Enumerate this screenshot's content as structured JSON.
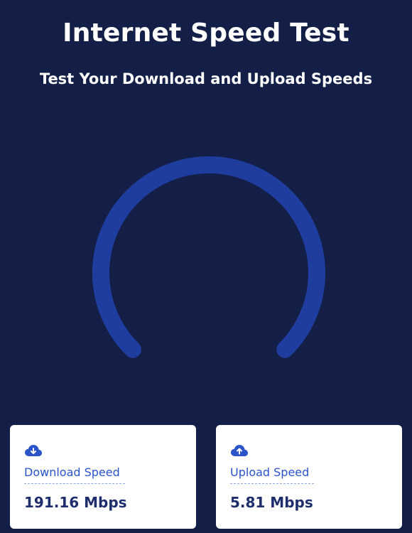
{
  "header": {
    "title": "Internet Speed Test",
    "subtitle": "Test Your Download and Upload Speeds"
  },
  "gauge": {
    "track_color": "#1f3d9e",
    "icon": "speed-gauge-icon"
  },
  "results": {
    "download": {
      "icon": "cloud-download-icon",
      "label": "Download Speed",
      "value": "191.16 Mbps"
    },
    "upload": {
      "icon": "cloud-upload-icon",
      "label": "Upload Speed",
      "value": "5.81 Mbps"
    }
  },
  "colors": {
    "background": "#131f47",
    "accent": "#2a54c8",
    "card": "#ffffff",
    "value_text": "#1e2d6b"
  }
}
